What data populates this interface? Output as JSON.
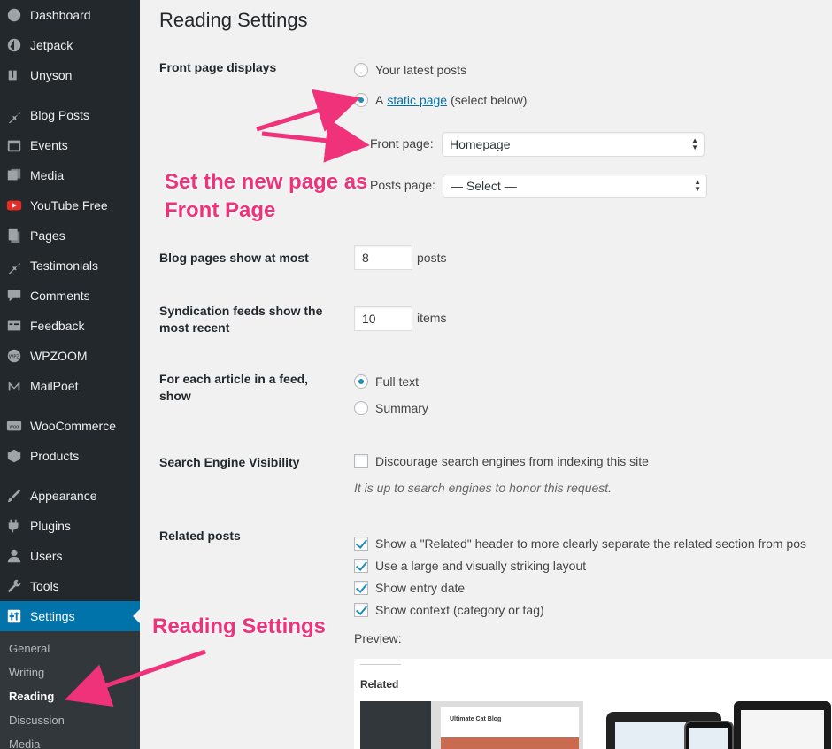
{
  "sidebar": {
    "items": [
      {
        "label": "Dashboard",
        "icon": "dashboard-icon"
      },
      {
        "label": "Jetpack",
        "icon": "jetpack-icon"
      },
      {
        "label": "Unyson",
        "icon": "unyson-icon"
      },
      {
        "label": "Blog Posts",
        "icon": "pin-icon"
      },
      {
        "label": "Events",
        "icon": "calendar-icon"
      },
      {
        "label": "Media",
        "icon": "media-icon"
      },
      {
        "label": "YouTube Free",
        "icon": "youtube-icon"
      },
      {
        "label": "Pages",
        "icon": "pages-icon"
      },
      {
        "label": "Testimonials",
        "icon": "pin-icon"
      },
      {
        "label": "Comments",
        "icon": "comment-icon"
      },
      {
        "label": "Feedback",
        "icon": "feedback-icon"
      },
      {
        "label": "WPZOOM",
        "icon": "wpzoom-icon"
      },
      {
        "label": "MailPoet",
        "icon": "mailpoet-icon"
      },
      {
        "label": "WooCommerce",
        "icon": "woocommerce-icon"
      },
      {
        "label": "Products",
        "icon": "products-icon"
      },
      {
        "label": "Appearance",
        "icon": "brush-icon"
      },
      {
        "label": "Plugins",
        "icon": "plugin-icon"
      },
      {
        "label": "Users",
        "icon": "user-icon"
      },
      {
        "label": "Tools",
        "icon": "wrench-icon"
      },
      {
        "label": "Settings",
        "icon": "settings-icon"
      }
    ],
    "submenu": [
      "General",
      "Writing",
      "Reading",
      "Discussion",
      "Media"
    ]
  },
  "page": {
    "title": "Reading Settings",
    "front_page_displays": {
      "label": "Front page displays",
      "opt_latest": "Your latest posts",
      "opt_static_prefix": "A",
      "opt_static_link": "static page",
      "opt_static_suffix": "(select below)",
      "front_page_label": "Front page:",
      "front_page_value": "Homepage",
      "posts_page_label": "Posts page:",
      "posts_page_value": "— Select —"
    },
    "blog_pages": {
      "label": "Blog pages show at most",
      "value": "8",
      "suffix": "posts"
    },
    "syndication": {
      "label": "Syndication feeds show the most recent",
      "value": "10",
      "suffix": "items"
    },
    "feed_article": {
      "label": "For each article in a feed, show",
      "opt_full": "Full text",
      "opt_summary": "Summary"
    },
    "search_visibility": {
      "label": "Search Engine Visibility",
      "option": "Discourage search engines from indexing this site",
      "desc": "It is up to search engines to honor this request."
    },
    "related": {
      "label": "Related posts",
      "options": [
        "Show a \"Related\" header to more clearly separate the related section from pos",
        "Use a large and visually striking layout",
        "Show entry date",
        "Show context (category or tag)"
      ],
      "preview_label": "Preview:",
      "preview_heading": "Related",
      "preview_blog_title": "Ultimate Cat Blog"
    }
  },
  "annotations": {
    "front_page_note": "Set the new page as Front Page",
    "reading_note": "Reading Settings"
  },
  "colors": {
    "accent": "#0073aa",
    "annotation": "#f0327a",
    "sidebar": "#23282d"
  }
}
